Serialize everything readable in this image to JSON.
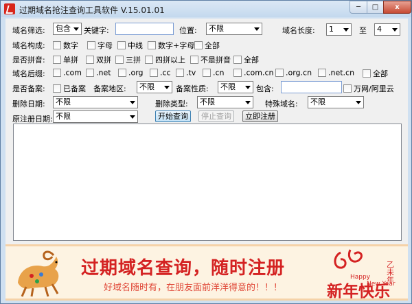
{
  "window": {
    "title": "过期域名抢注查询工具软件 V.15.01.01",
    "controls": {
      "minimize": "─",
      "maximize": "□",
      "close": "x"
    }
  },
  "filter": {
    "label": "域名筛选:",
    "mode": "包含",
    "keyword_label": "关键字:",
    "keyword_value": "",
    "position_label": "位置:",
    "position_value": "不限",
    "length_label": "域名长度:",
    "length_min": "1",
    "length_to": "至",
    "length_max": "4"
  },
  "composition": {
    "label": "域名构成:",
    "options": [
      {
        "text": "数字",
        "checked": false
      },
      {
        "text": "字母",
        "checked": false
      },
      {
        "text": "中线",
        "checked": false
      },
      {
        "text": "数字+字母",
        "checked": false
      },
      {
        "text": "全部",
        "checked": false
      }
    ]
  },
  "pinyin": {
    "label": "是否拼音:",
    "options": [
      {
        "text": "单拼",
        "checked": false
      },
      {
        "text": "双拼",
        "checked": false
      },
      {
        "text": "三拼",
        "checked": false
      },
      {
        "text": "四拼以上",
        "checked": false
      },
      {
        "text": "不是拼音",
        "checked": false
      },
      {
        "text": "全部",
        "checked": false
      }
    ]
  },
  "suffix": {
    "label": "域名后缀:",
    "options": [
      {
        "text": ".com",
        "checked": false
      },
      {
        "text": ".net",
        "checked": false
      },
      {
        "text": ".org",
        "checked": false
      },
      {
        "text": ".cc",
        "checked": false
      },
      {
        "text": ".tv",
        "checked": false
      },
      {
        "text": ".cn",
        "checked": false
      },
      {
        "text": ".com.cn",
        "checked": false
      },
      {
        "text": ".org.cn",
        "checked": false
      },
      {
        "text": ".net.cn",
        "checked": false
      },
      {
        "text": "全部",
        "checked": false
      }
    ]
  },
  "record": {
    "label": "是否备案:",
    "recorded_label": "已备案",
    "region_label": "备案地区:",
    "region_value": "不限",
    "nature_label": "备案性质:",
    "nature_value": "不限",
    "contains_label": "包含:",
    "contains_value": "",
    "wanwang_label": "万网/阿里云"
  },
  "delete": {
    "date_label": "删除日期:",
    "date_value": "不限",
    "type_label": "删除类型:",
    "type_value": "不限",
    "special_label": "特殊域名:",
    "special_value": "不限"
  },
  "original": {
    "date_label": "原注册日期:",
    "date_value": "不限"
  },
  "actions": {
    "start": "开始查询",
    "stop": "停止查询",
    "register": "立即注册"
  },
  "banner": {
    "headline": "过期域名查询，随时注册",
    "subline": "好域名随时有，在朋友面前洋洋得意的！！！",
    "new_year": "新年快乐",
    "year_label": "乙未年",
    "happy": "Happy",
    "newyear_en": "New Year",
    "colors": {
      "red": "#d42222",
      "bg": "#fdf3e2"
    }
  }
}
